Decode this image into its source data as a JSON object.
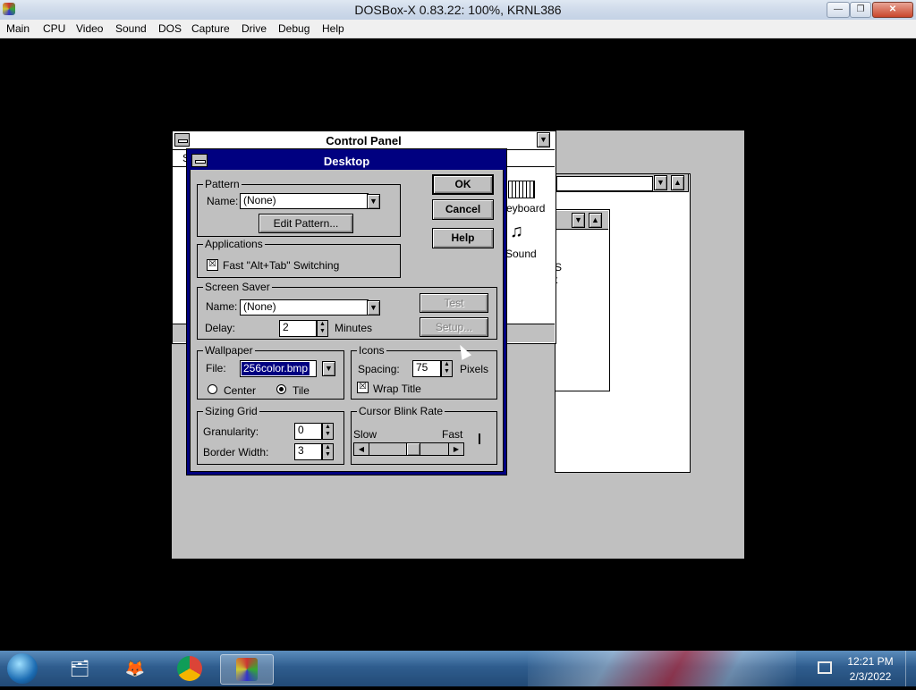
{
  "host": {
    "title": "DOSBox-X 0.83.22: 100%, KRNL386",
    "menu": [
      "Main",
      "CPU",
      "Video",
      "Sound",
      "DOS",
      "Capture",
      "Drive",
      "Debug",
      "Help"
    ],
    "window_buttons": {
      "minimize": "—",
      "restore": "❐",
      "close": "✕"
    }
  },
  "control_panel": {
    "title": "Control Panel",
    "icons": [
      {
        "label": "eyboard"
      },
      {
        "label": "Sound"
      }
    ],
    "partial_text": [
      "S",
      "S",
      "t"
    ]
  },
  "desktop_dialog": {
    "title": "Desktop",
    "buttons": {
      "ok": "OK",
      "cancel": "Cancel",
      "help": "Help"
    },
    "pattern": {
      "group_label": "Pattern",
      "name_label": "Name:",
      "name_value": "(None)",
      "edit_button": "Edit Pattern..."
    },
    "applications": {
      "group_label": "Applications",
      "fast_switch_label": "Fast \"Alt+Tab\" Switching",
      "fast_switch_checked": "☒"
    },
    "screen_saver": {
      "group_label": "Screen Saver",
      "name_label": "Name:",
      "name_value": "(None)",
      "delay_label": "Delay:",
      "delay_value": "2",
      "delay_unit": "Minutes",
      "test_button": "Test",
      "setup_button": "Setup..."
    },
    "wallpaper": {
      "group_label": "Wallpaper",
      "file_label": "File:",
      "file_value": "256color.bmp",
      "center_label": "Center",
      "tile_label": "Tile",
      "selected": "Tile"
    },
    "icons": {
      "group_label": "Icons",
      "spacing_label": "Spacing:",
      "spacing_value": "75",
      "spacing_unit": "Pixels",
      "wrap_label": "Wrap Title",
      "wrap_checked": "☒"
    },
    "sizing_grid": {
      "group_label": "Sizing Grid",
      "granularity_label": "Granularity:",
      "granularity_value": "0",
      "border_label": "Border Width:",
      "border_value": "3"
    },
    "cursor_blink": {
      "group_label": "Cursor Blink Rate",
      "slow_label": "Slow",
      "fast_label": "Fast",
      "rate_fraction": 0.55
    }
  },
  "taskbar": {
    "time": "12:21 PM",
    "date": "2/3/2022",
    "items": [
      "start-orb",
      "file-explorer",
      "firefox",
      "chrome",
      "dosbox"
    ]
  }
}
